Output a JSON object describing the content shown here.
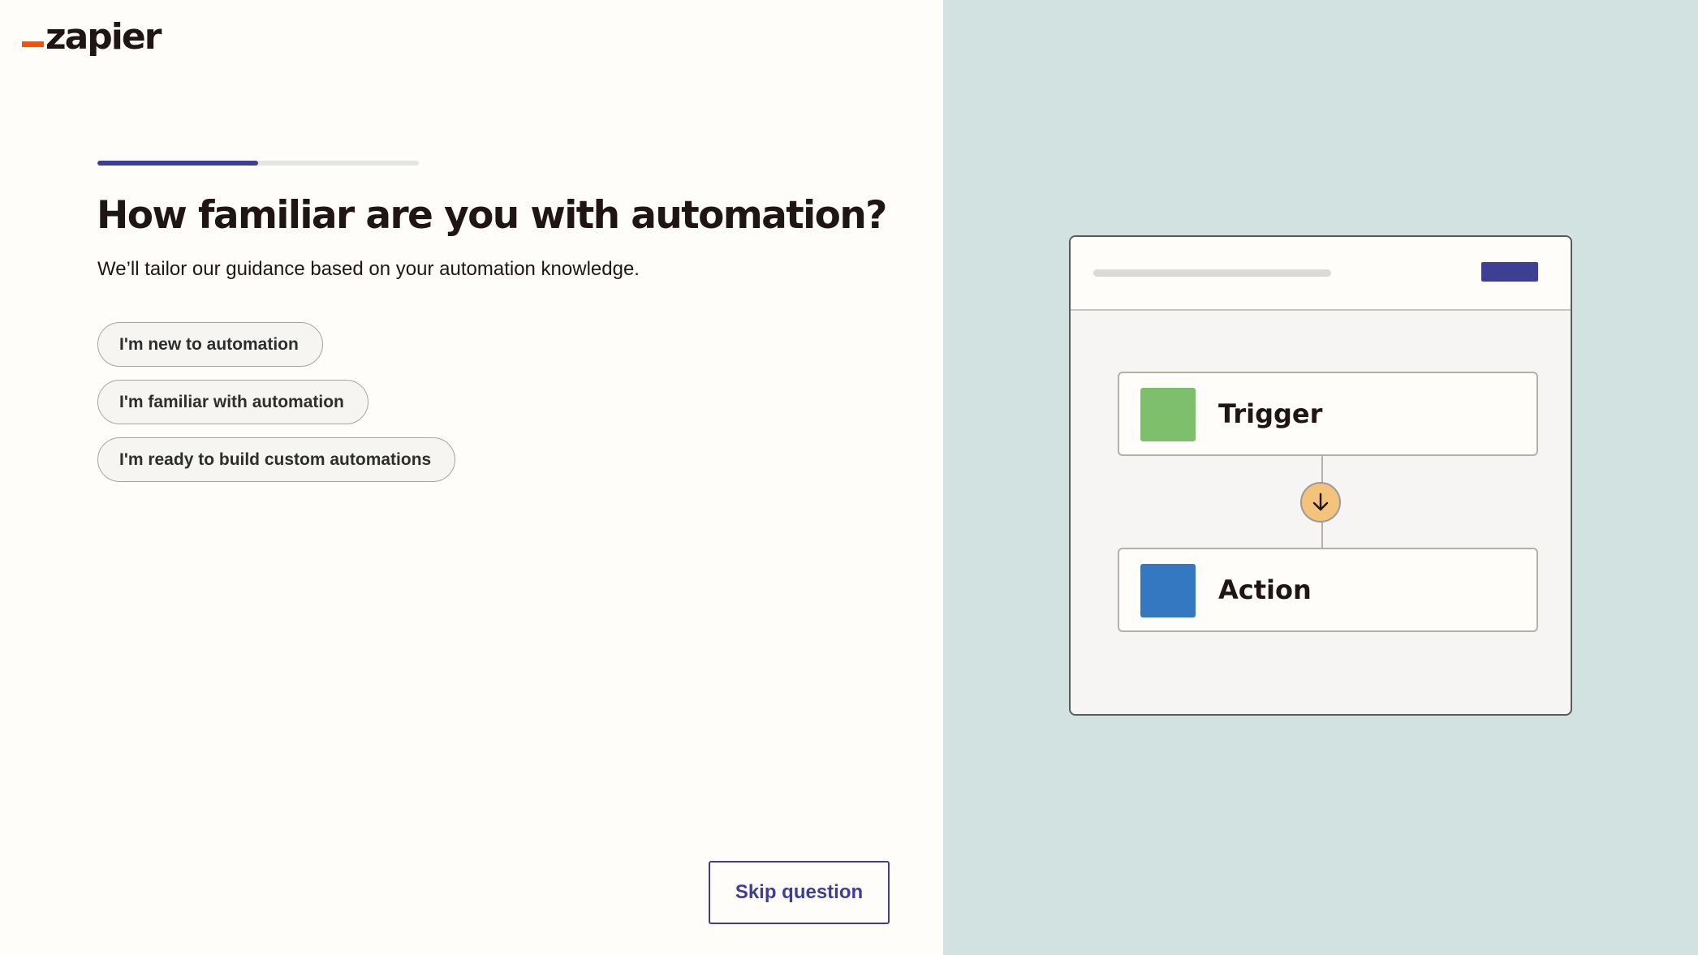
{
  "brand": {
    "logo_text": "zapier",
    "accent_color": "#ff4f00",
    "primary_color": "#3d3f94"
  },
  "progress": {
    "fraction": 0.5
  },
  "question": {
    "title": "How familiar are you with automation?",
    "subtitle": "We’ll tailor our guidance based on your automation knowledge."
  },
  "options": [
    {
      "label": "I'm new to automation"
    },
    {
      "label": "I'm familiar with automation"
    },
    {
      "label": "I'm ready to build custom automations"
    }
  ],
  "skip_label": "Skip question",
  "illustration": {
    "trigger": {
      "label": "Trigger",
      "color": "#7dbf6d"
    },
    "action": {
      "label": "Action",
      "color": "#3478c1"
    },
    "arrow_icon": "arrow-down-icon",
    "arrow_color": "#f3c27b"
  }
}
